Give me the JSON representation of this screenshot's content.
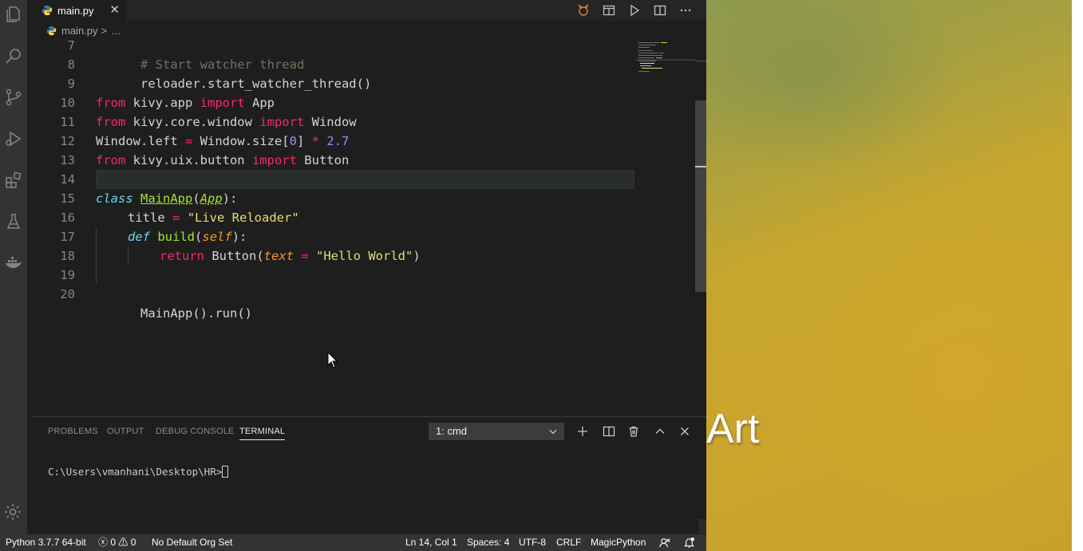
{
  "tab": {
    "filename": "main.py",
    "close": "✕"
  },
  "breadcrumb": {
    "file": "main.py",
    "separator": ">",
    "rest": "..."
  },
  "editor": {
    "line_numbers": [
      "7",
      "8",
      "9",
      "10",
      "11",
      "12",
      "13",
      "14",
      "15",
      "16",
      "17",
      "18",
      "19",
      "20"
    ],
    "current_line": "14"
  },
  "code": {
    "l7": {
      "text": "# Start watcher thread"
    },
    "l8": {
      "text": "reloader.start_watcher_thread()"
    },
    "l10": {
      "from": "from",
      "mod": " kivy.app ",
      "import": "import",
      "name": " App"
    },
    "l11": {
      "from": "from",
      "mod": " kivy.core.window ",
      "import": "import",
      "name": " Window"
    },
    "l12": {
      "a": "Window.left ",
      "eq": "=",
      "b": " Window.size[",
      "idx": "0",
      "c": "] ",
      "mul": "*",
      "sp": " ",
      "num": "2.7"
    },
    "l13": {
      "from": "from",
      "mod": " kivy.uix.button ",
      "import": "import",
      "name": " Button"
    },
    "l15": {
      "kw": "class",
      "sp": " ",
      "cls": "MainApp",
      "p1": "(",
      "base": "App",
      "p2": "):"
    },
    "l16": {
      "a": "title ",
      "eq": "=",
      "sp": " ",
      "str": "\"Live Reloader\""
    },
    "l17": {
      "kw": "def",
      "sp": " ",
      "fn": "build",
      "p1": "(",
      "self": "self",
      "p2": "):"
    },
    "l18": {
      "kw": "return",
      "a": " Button(",
      "arg": "text",
      "sp1": " ",
      "eq": "=",
      "sp2": " ",
      "str": "\"Hello World\"",
      "p2": ")"
    },
    "l20": {
      "text": "MainApp().run()"
    }
  },
  "panel": {
    "tabs": [
      "PROBLEMS",
      "OUTPUT",
      "DEBUG CONSOLE",
      "TERMINAL"
    ],
    "active_tab": "TERMINAL",
    "terminal_select": "1: cmd",
    "prompt": "C:\\Users\\vmanhani\\Desktop\\HR>"
  },
  "statusbar": {
    "interpreter": "Python 3.7.7 64-bit",
    "errors": "0",
    "warnings": "0",
    "org": "No Default Org Set",
    "position": "Ln 14, Col 1",
    "spaces": "Spaces: 4",
    "encoding": "UTF-8",
    "eol": "CRLF",
    "language": "MagicPython"
  },
  "app_window": {
    "button_text": "Art"
  },
  "colors": {
    "keyword": "#f92672",
    "string": "#e6db74",
    "number": "#ae81ff",
    "function": "#a6e22e",
    "storage": "#66d9ef",
    "parameter": "#fd971f",
    "app_background": "#c8a12c"
  }
}
